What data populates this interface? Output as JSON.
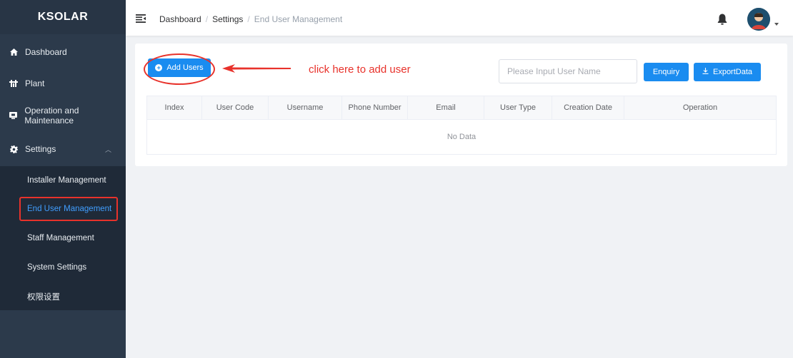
{
  "brand": "KSOLAR",
  "menu": {
    "items": [
      {
        "label": "Dashboard",
        "icon": "home-icon"
      },
      {
        "label": "Plant",
        "icon": "plant-icon"
      },
      {
        "label": "Operation and Maintenance",
        "icon": "maintenance-icon"
      },
      {
        "label": "Settings",
        "icon": "gear-icon"
      }
    ],
    "settings_children": [
      {
        "label": "Installer Management"
      },
      {
        "label": "End User Management"
      },
      {
        "label": "Staff Management"
      },
      {
        "label": "System Settings"
      },
      {
        "label": "权限设置"
      }
    ]
  },
  "breadcrumb": [
    "Dashboard",
    "Settings",
    "End User Management"
  ],
  "toolbar": {
    "add_label": "Add Users",
    "annotation": "click here to add user",
    "search_placeholder": "Please Input User Name",
    "enquiry_label": "Enquiry",
    "export_label": "ExportData"
  },
  "table": {
    "columns": [
      "Index",
      "User Code",
      "Username",
      "Phone Number",
      "Email",
      "User Type",
      "Creation Date",
      "Operation"
    ],
    "empty_text": "No Data"
  },
  "colors": {
    "primary": "#1a8cf0",
    "sidebar": "#2c3a4b",
    "highlight": "#e8322b"
  }
}
